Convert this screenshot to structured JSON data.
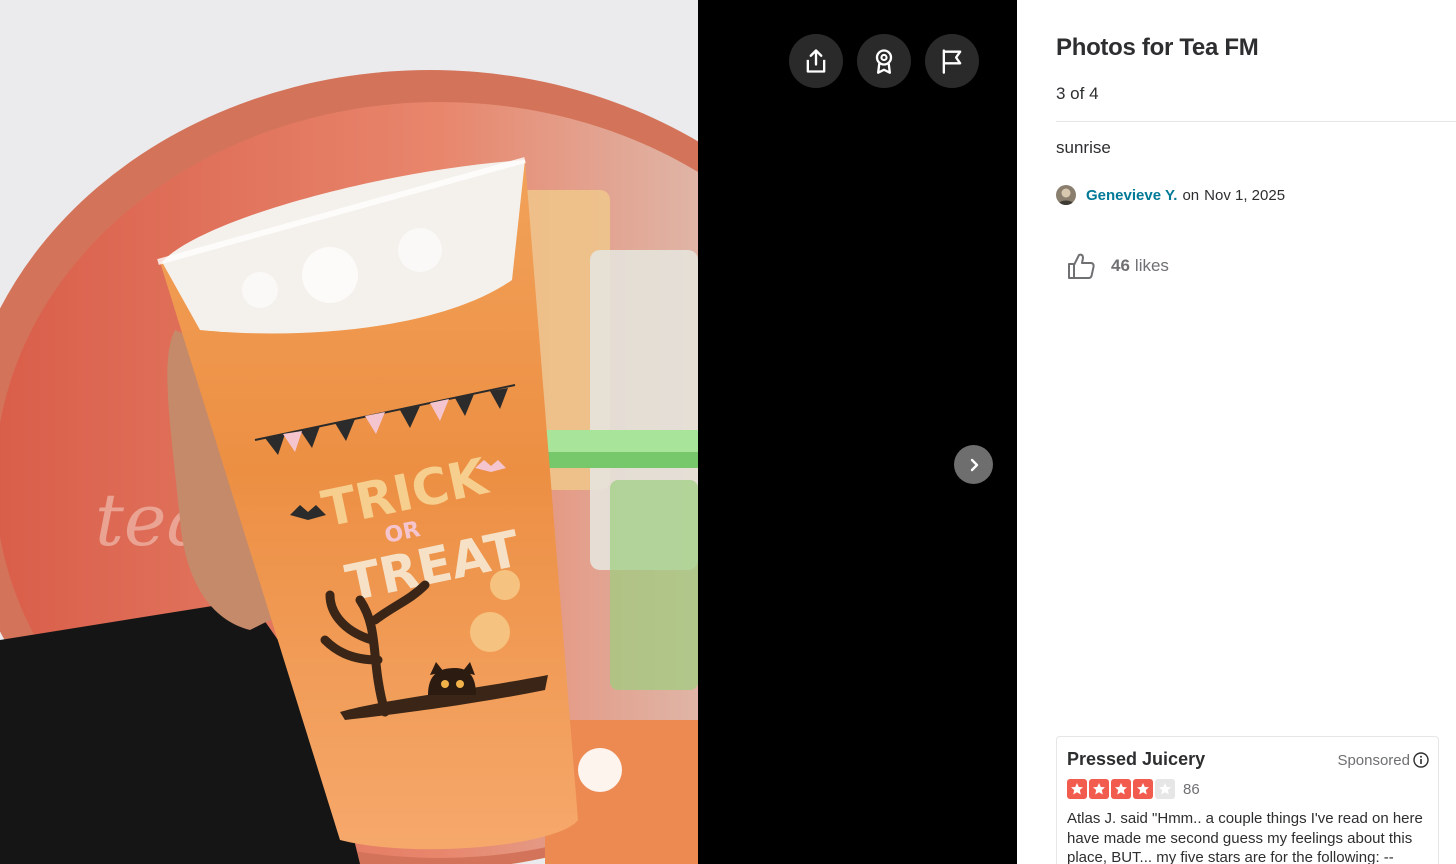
{
  "viewer": {
    "photo_alt": "sunrise",
    "actions": [
      {
        "name": "share",
        "icon": "share-icon"
      },
      {
        "name": "compliment",
        "icon": "award-ribbon-icon"
      },
      {
        "name": "report",
        "icon": "flag-icon"
      }
    ],
    "next_icon": "chevron-right-icon",
    "cup_text_line1": "TRICK",
    "cup_text_line2": "OR",
    "cup_text_line3": "TREAT",
    "shop_sign_text": "tea"
  },
  "sidebar": {
    "title": "Photos for Tea FM",
    "counter": "3 of 4",
    "caption": "sunrise",
    "author": {
      "name": "Genevieve Y.",
      "on": "on",
      "date": "Nov 1, 2025",
      "avatar_icon": "user-avatar"
    },
    "likes": {
      "icon": "thumbs-up-icon",
      "count": "46",
      "label": "likes"
    }
  },
  "ad": {
    "business_name": "Pressed Juicery",
    "sponsored_label": "Sponsored",
    "info_icon": "info-icon",
    "rating": 4,
    "rating_max": 5,
    "review_count": "86",
    "snippet": "Atlas J. said \"Hmm.. a couple things I've read on here have made me second guess my feelings about this place, BUT... my five stars are for the following: --",
    "colors": {
      "star_filled": "#f15c4f",
      "star_empty": "#e6e6e6"
    }
  },
  "colors": {
    "viewer_bg": "#000000",
    "action_button_bg": "#2a2a2a",
    "link": "#027a97",
    "muted_text": "#6e7072"
  }
}
